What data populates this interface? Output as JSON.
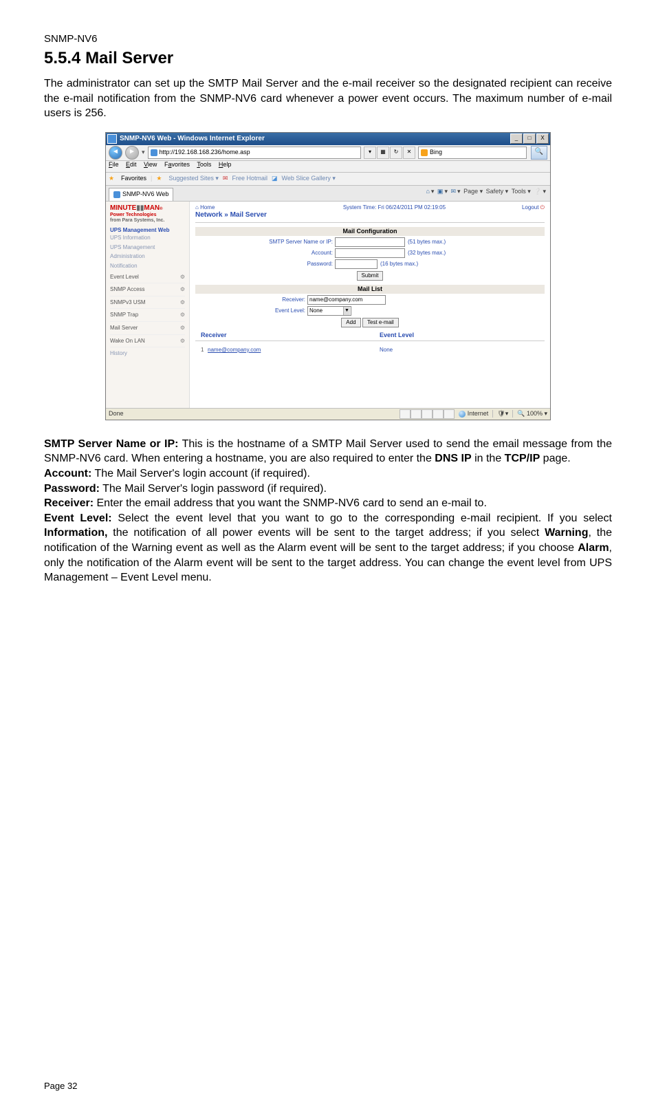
{
  "doc": {
    "product": "SNMP-NV6",
    "section_number": "5.5.4",
    "section_title": "Mail Server",
    "intro": "The administrator can set up the SMTP Mail Server and the e-mail receiver so the designated recipient can receive the e-mail notification from the SNMP-NV6 card whenever a power event occurs. The maximum number of e-mail users is 256.",
    "page_label": "Page 32"
  },
  "defs": {
    "smtp_label": "SMTP Server Name or IP:",
    "smtp_text": " This is the hostname of a SMTP Mail Server used to send the email message from the SNMP-NV6 card. When entering a hostname, you are also required to enter the ",
    "smtp_text2": " in the ",
    "smtp_text3": " page.",
    "dns_ip": "DNS IP",
    "tcpip": "TCP/IP",
    "account_label": "Account:",
    "account_text": " The Mail Server's login account (if required).",
    "password_label": "Password:",
    "password_text": " The Mail Server's login password (if required).",
    "receiver_label": "Receiver:",
    "receiver_text": " Enter the email address that you want the SNMP-NV6 card to send an e-mail to.",
    "event_label": "Event Level:",
    "event_text_a": " Select the event level that you want to go to the corresponding e-mail recipient. If you select ",
    "info": "Information,",
    "event_text_b": " the notification of all power events will be sent to the target address; if you select ",
    "warning": "Warning",
    "event_text_c": ", the notification of the Warning event as well as the Alarm event will be sent to the target address; if you choose ",
    "alarm": "Alarm",
    "event_text_d": ", only the notification of the Alarm event will be sent to the target address. You can change the event level from UPS Management – Event Level menu."
  },
  "ie": {
    "title": "SNMP-NV6 Web - Windows Internet Explorer",
    "url": "http://192.168.168.236/home.asp",
    "search_provider": "Bing",
    "menus": {
      "file": "File",
      "edit": "Edit",
      "view": "View",
      "fav": "Favorites",
      "tools": "Tools",
      "help": "Help"
    },
    "fav_label": "Favorites",
    "fav_links": {
      "suggested": "Suggested Sites ▾",
      "hotmail": "Free Hotmail",
      "gallery": "Web Slice Gallery ▾"
    },
    "tab": "SNMP-NV6 Web",
    "cmd": {
      "page": "Page ▾",
      "safety": "Safety ▾",
      "tools": "Tools ▾"
    },
    "status_done": "Done",
    "status_zone": "Internet",
    "status_zoom": "100%"
  },
  "app": {
    "brand1a": "MINUTE",
    "brand1b": "MAN",
    "brand2": "Power Technologies",
    "brand3": "from Para Systems, Inc.",
    "nav_head": "UPS Management Web",
    "nav_items": [
      "UPS Information",
      "UPS Management",
      "Administration",
      "Notification"
    ],
    "sub_items": [
      "Event Level",
      "SNMP Access",
      "SNMPv3 USM",
      "SNMP Trap",
      "Mail Server",
      "Wake On LAN"
    ],
    "history": "History",
    "home": "Home",
    "breadcrumb": "Network » Mail Server",
    "system_time": "System Time: Fri 06/24/2011 PM 02:19:05",
    "logout": "Logout",
    "mail_cfg_title": "Mail Configuration",
    "smtp_label": "SMTP Server Name or IP:",
    "smtp_hint": "(51 bytes max.)",
    "account_label": "Account:",
    "account_hint": "(32 bytes max.)",
    "password_label": "Password:",
    "password_hint": "(16 bytes max.)",
    "submit": "Submit",
    "mail_list_title": "Mail List",
    "receiver_label": "Receiver:",
    "receiver_value": "name@company.com",
    "eventlevel_label": "Event Level:",
    "eventlevel_value": "None",
    "add": "Add",
    "test": "Test e-mail",
    "col_receiver": "Receiver",
    "col_event": "Event Level",
    "row1_idx": "1",
    "row1_receiver": "name@company.com",
    "row1_level": "None"
  }
}
